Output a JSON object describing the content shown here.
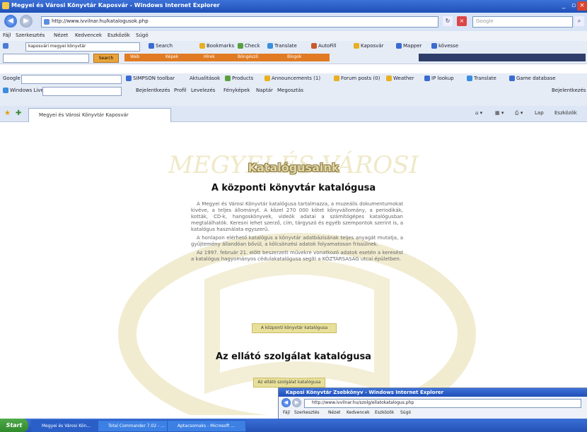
{
  "window": {
    "title": "Megyei és Városi Könyvtár Kaposvár - Windows Internet Explorer"
  },
  "address": {
    "url": "http://www.ivvilnar.hu/katalogusok.php",
    "search_placeholder": "Google"
  },
  "menu": [
    "Fájl",
    "Szerkesztés",
    "Nézet",
    "Kedvencek",
    "Eszközök",
    "Súgó"
  ],
  "toolbar1": {
    "search_value": "kaposvári megyei könyvtár",
    "items": [
      "Search",
      "Bookmarks",
      "Check",
      "Translate",
      "AutoFill",
      "Kaposvár",
      "Mapper",
      "kövesse"
    ]
  },
  "toolbar2": {
    "search_label": "Search",
    "tab_labels": [
      "Web",
      "Képek",
      "Hírek",
      "Böngésző",
      "Blogok"
    ]
  },
  "toolbar3": {
    "label": "Google",
    "items": [
      "SIMPSON toolbar",
      "Aktualitások",
      "Products",
      "Announcements (1)",
      "Forum posts (0)",
      "Weather",
      "IP lookup",
      "Translate",
      "Game database"
    ]
  },
  "toolbar4": {
    "label": "Windows Live",
    "items": [
      "Bejelentkezés",
      "Profil",
      "Levelezés",
      "Fényképek",
      "Naptár",
      "Megosztás"
    ],
    "right_label": "Bejelentkezés"
  },
  "tab": {
    "label": "Megyei és Városi Könyvtár Kaposvár",
    "right_items": [
      "Lap",
      "Eszközök"
    ]
  },
  "content": {
    "logo_title": "Katalógusaink",
    "watermark_text": "MEGYEI ÉS VÁROSI",
    "heading1": "A központi könyvtár katalógusa",
    "paragraph1": "A Megyei és Városi Könyvtár katalógusa tartalmazza, a muzeális dokumentumokat kivéve, a teljes állományt. A közel 270 000 kötet könyvállomány, a periodikák, kották, CD-k, hangoskönyvek, videók adatai a számítógépes katalógusban megtalálhatók. Keresni lehet szerző, cím, tárgyszó és egyéb szempontok szerint is, a katalógus használata egyszerű.",
    "paragraph2": "A honlapon elérhető katalógus a könyvtár adatbázisának teljes anyagát mutatja, a gyűjtemény állandóan bővül, a kölcsönzési adatok folyamatosan frissülnek.",
    "paragraph3": "Az 1997. február 21. előtt beszerzett művekre vonatkozó adatok esetén a keresést a katalógus hagyományos cédulakatalógusa segíti a KÖZTÁRSASÁG utcai épületben.",
    "button1": "A központi könyvtár katalógusa",
    "heading2": "Az ellátó szolgálat katalógusa",
    "button2": "Az ellátó szolgálat katalógusa"
  },
  "popup": {
    "title": "Kaposi Könyvtár Zsebkönyv - Windows Internet Explorer",
    "url": "http://www.ivvilnar.hu/szolg/ellatokatalogus.php",
    "menu": [
      "Fájl",
      "Szerkesztés",
      "Nézet",
      "Kedvencek",
      "Eszközök",
      "Súgó"
    ]
  },
  "taskbar": {
    "start": "Start",
    "tasks": [
      "Megyei és Városi Kön...",
      "Total Commander 7.02 - ...",
      "Aptacsomaks - Microsoft ..."
    ]
  }
}
